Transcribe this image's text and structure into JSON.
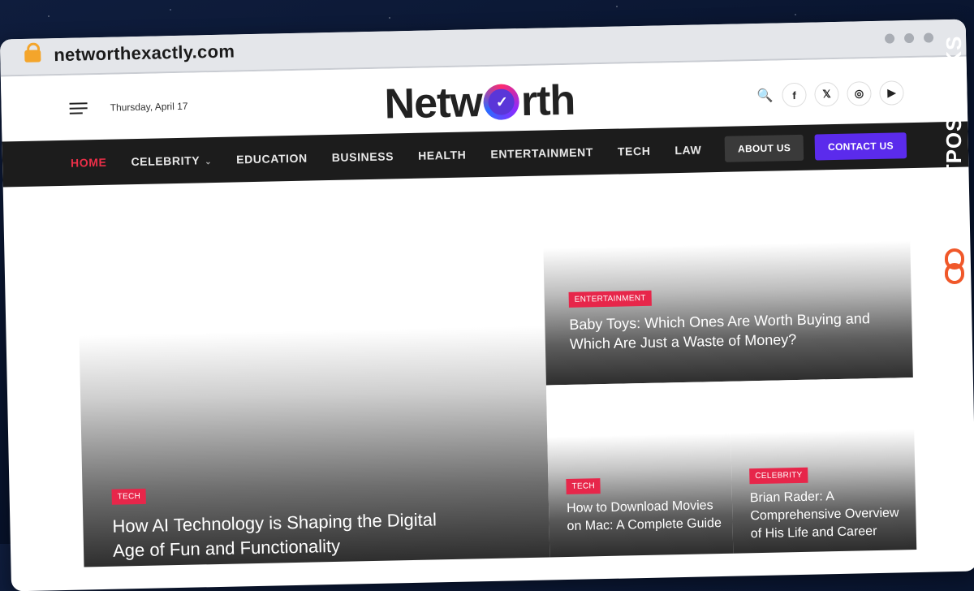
{
  "browser": {
    "url": "networthexactly.com"
  },
  "header": {
    "date": "Thursday, April 17",
    "logo_pre": "Netw",
    "logo_post": "rth",
    "logo_mark": "✓"
  },
  "social": {
    "search": "🔍",
    "facebook": "f",
    "x": "𝕏",
    "instagram": "◎",
    "youtube": "▶"
  },
  "nav": {
    "items": [
      {
        "label": "HOME"
      },
      {
        "label": "CELEBRITY"
      },
      {
        "label": "EDUCATION"
      },
      {
        "label": "BUSINESS"
      },
      {
        "label": "HEALTH"
      },
      {
        "label": "ENTERTAINMENT"
      },
      {
        "label": "TECH"
      },
      {
        "label": "LAW"
      }
    ],
    "chevron": "⌄",
    "about_label": "ABOUT US",
    "contact_label": "CONTACT US"
  },
  "posts": {
    "featured": {
      "category": "TECH",
      "title": "How AI Technology is Shaping the Digital Age of Fun and Functionality"
    },
    "top_right": {
      "category": "ENTERTAINMENT",
      "title": "Baby Toys: Which Ones Are Worth Buying and Which Are Just a Waste of Money?"
    },
    "small_left": {
      "category": "TECH",
      "title": "How to Download Movies on Mac: A Complete Guide"
    },
    "small_right": {
      "category": "CELEBRITY",
      "title": "Brian Rader: A Comprehensive Overview of His Life and Career"
    }
  },
  "watermark": {
    "text": "GUESTPOSTLINKS"
  },
  "colors": {
    "accent_red": "#e7264a",
    "contact_purple": "#5b2bec",
    "nav_bg": "#1c1c1c",
    "watermark_orange": "#f0582a"
  }
}
